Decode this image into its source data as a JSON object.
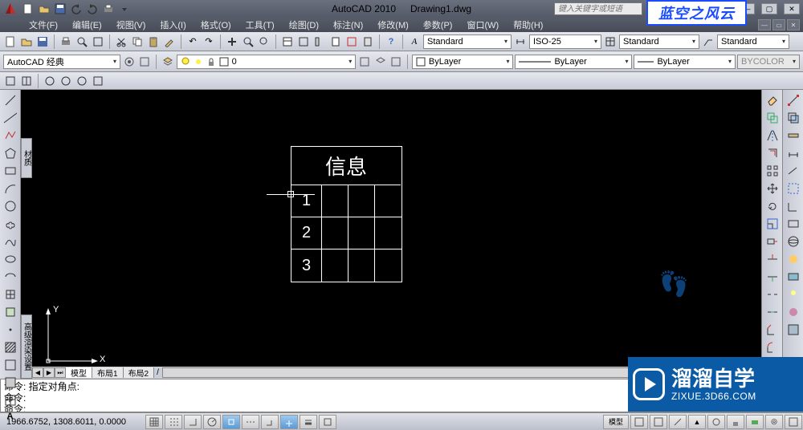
{
  "title": {
    "app": "AutoCAD 2010",
    "doc": "Drawing1.dwg"
  },
  "search": {
    "placeholder": "键入关键字或短语"
  },
  "watermark_top": "蓝空之风云",
  "watermark_bottom": {
    "line1": "溜溜自学",
    "line2": "ZIXUE.3D66.COM"
  },
  "menu": {
    "file": "文件(F)",
    "edit": "编辑(E)",
    "view": "视图(V)",
    "insert": "插入(I)",
    "format": "格式(O)",
    "tools": "工具(T)",
    "draw": "绘图(D)",
    "dimension": "标注(N)",
    "modify": "修改(M)",
    "param": "参数(P)",
    "window": "窗口(W)",
    "help": "帮助(H)"
  },
  "toolbar1": {
    "text_style": "Standard",
    "dim_style": "ISO-25",
    "table_style": "Standard",
    "mleader_style": "Standard"
  },
  "workspace": {
    "name": "AutoCAD 经典"
  },
  "layer": {
    "current": "0"
  },
  "properties": {
    "color": "ByLayer",
    "linetype": "ByLayer",
    "lineweight": "ByLayer",
    "plotstyle": "BYCOLOR"
  },
  "side_tab1": "材质",
  "side_tab2": "高级渲染设置",
  "drawing": {
    "table_header": "信息",
    "rows": [
      "1",
      "2",
      "3"
    ],
    "ucs": {
      "y": "Y",
      "x": "X"
    }
  },
  "tabs": {
    "model": "模型",
    "layout1": "布局1",
    "layout2": "布局2"
  },
  "cmd": {
    "line1": "命令: 指定对角点:",
    "line2": "命令:",
    "prompt": "命令:"
  },
  "status": {
    "coords": "1966.6752, 1308.6011, 0.0000",
    "model_label": "模型"
  }
}
